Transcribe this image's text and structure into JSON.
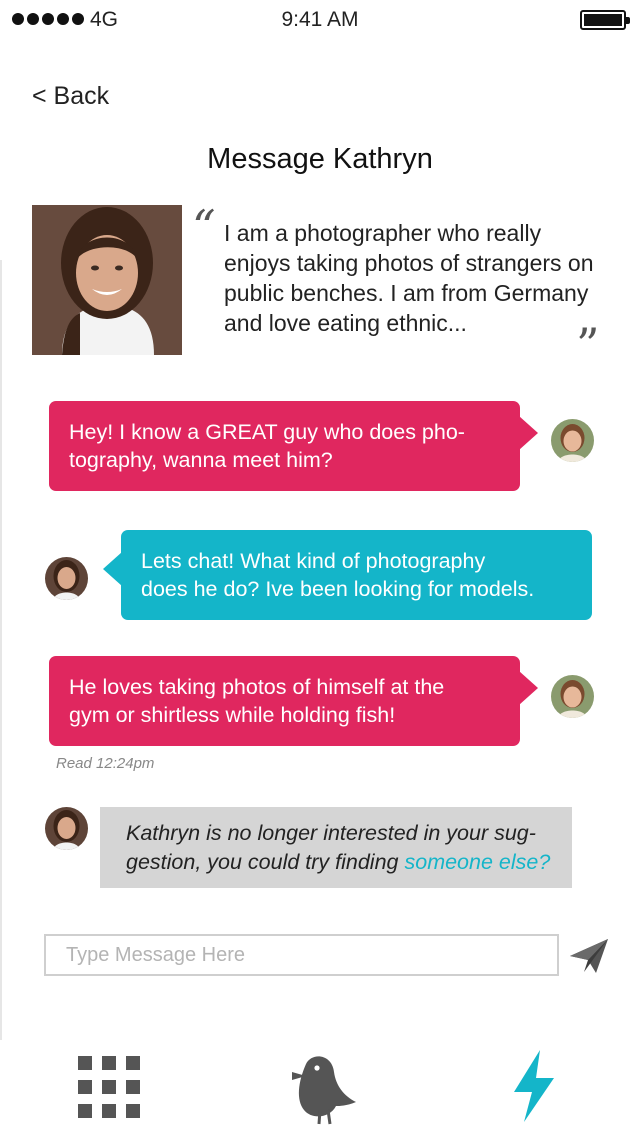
{
  "status_bar": {
    "carrier": "4G",
    "time": "9:41 AM"
  },
  "nav": {
    "back_label": "< Back",
    "title": "Message Kathryn"
  },
  "profile": {
    "bio": "I am a photographer who really enjoys taking photos of strangers on public benches. I am from Germany and love eating ethnic...",
    "quote_open": "“",
    "quote_close": "”"
  },
  "messages": [
    {
      "sender": "me",
      "lines": [
        "Hey! I know a GREAT guy who does pho-",
        "tography, wanna meet him?"
      ]
    },
    {
      "sender": "kathryn",
      "lines": [
        "Lets chat! What kind of photography",
        "does he do? Ive been looking for models."
      ]
    },
    {
      "sender": "me",
      "lines": [
        "He loves taking photos of himself at the",
        "gym or shirtless while holding fish!"
      ]
    }
  ],
  "read_receipt": "Read 12:24pm",
  "system_note": {
    "line1": "Kathryn is no longer interested in your sug-",
    "line2_prefix": "gestion, you could try finding ",
    "link": "someone else?"
  },
  "composer": {
    "placeholder": "Type Message Here",
    "send_icon": "paper-plane-icon"
  },
  "tab_bar": {
    "items": [
      "grid-icon",
      "bird-icon",
      "lightning-icon"
    ]
  },
  "colors": {
    "pink": "#e0275f",
    "teal": "#14b5c9",
    "note_bg": "#d5d5d5",
    "icon_gray": "#555555"
  }
}
